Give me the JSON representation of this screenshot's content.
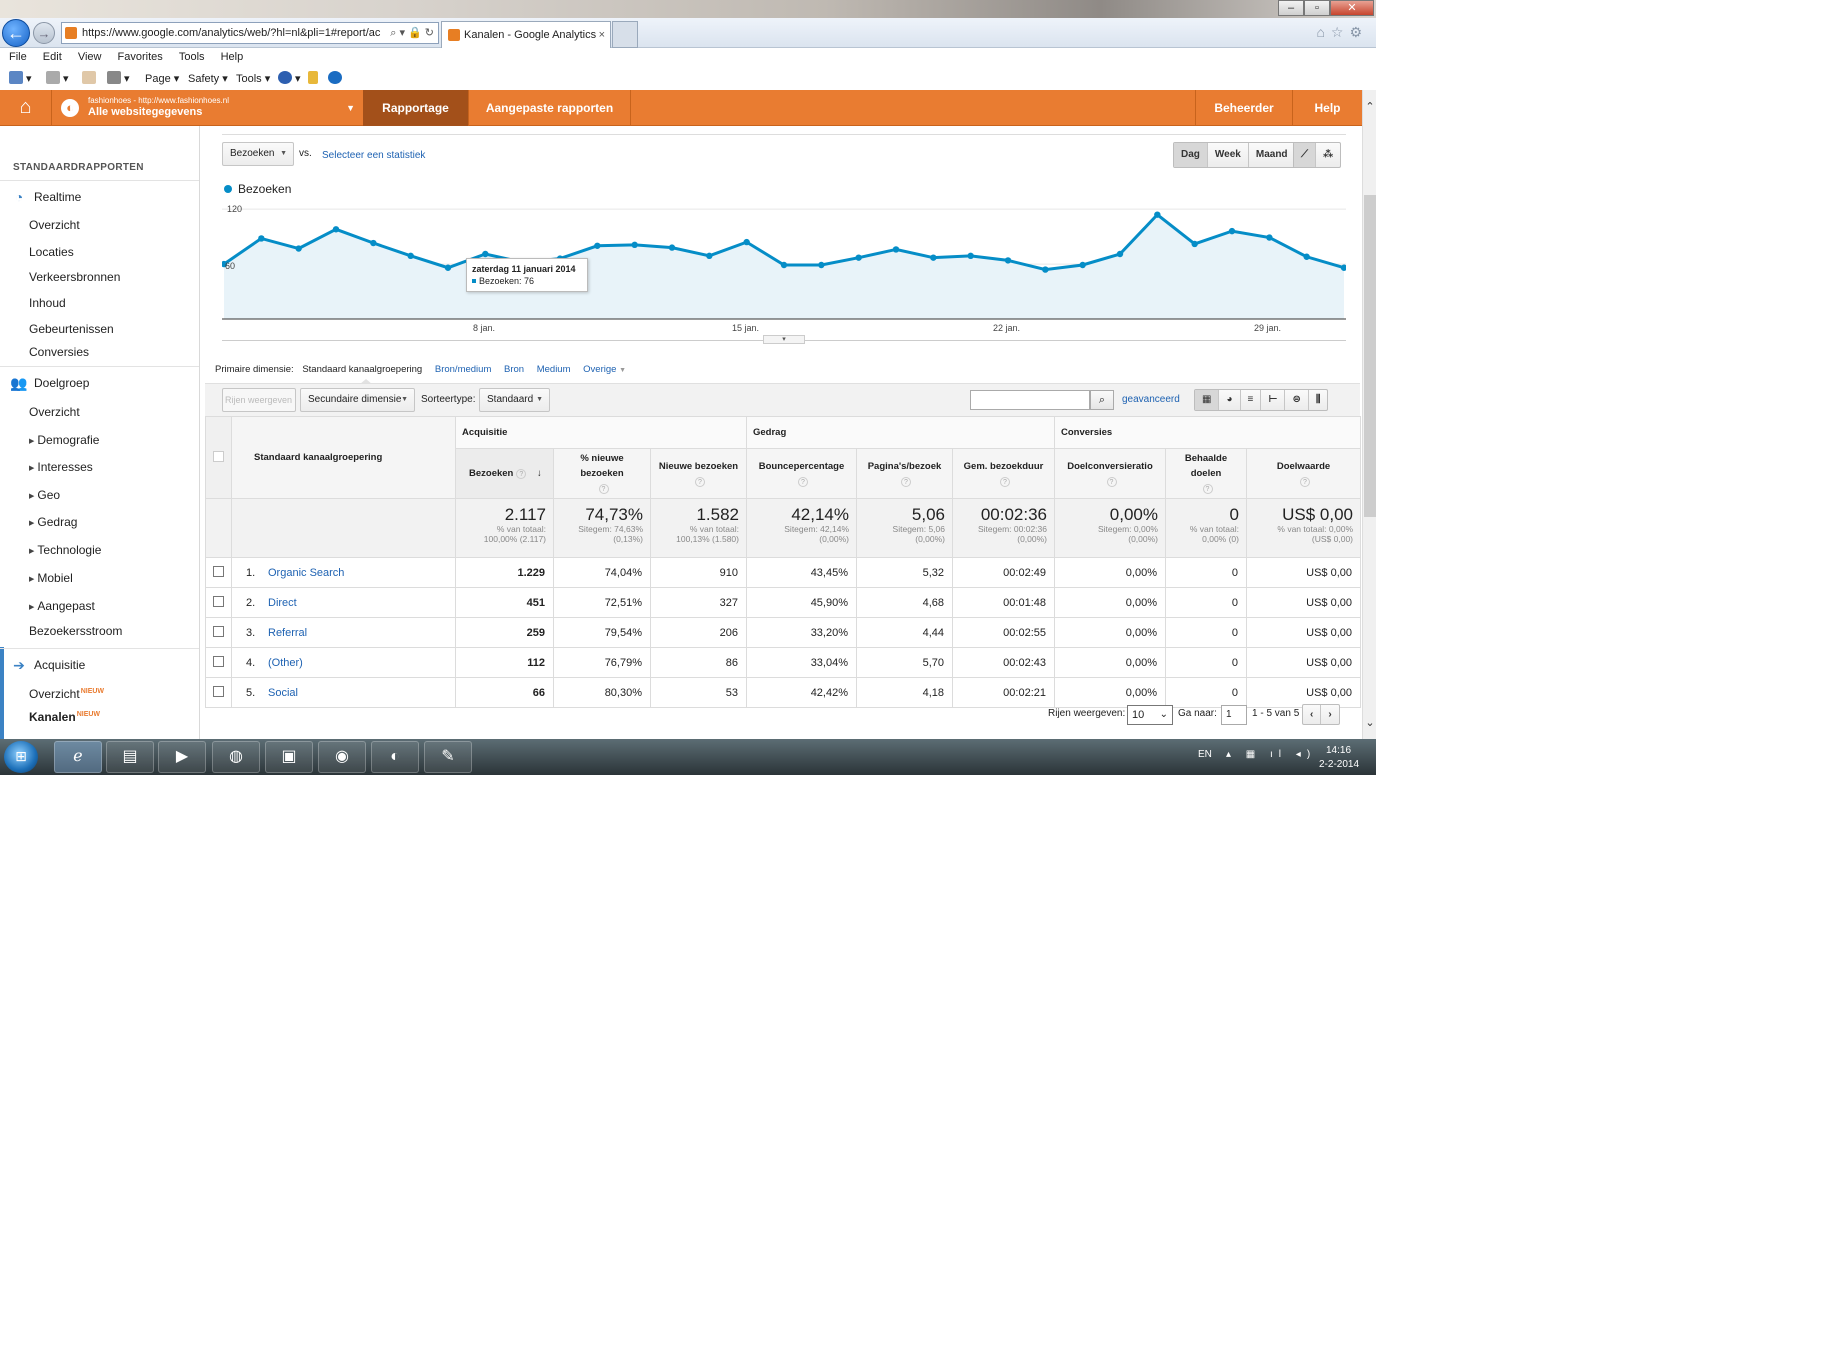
{
  "browser": {
    "url": "https://www.google.com/analytics/web/?hl=nl&pli=1#report/ac",
    "tab_title": "Kanalen - Google Analytics",
    "menu": [
      "File",
      "Edit",
      "View",
      "Favorites",
      "Tools",
      "Help"
    ],
    "commands": {
      "page": "Page",
      "safety": "Safety",
      "tools": "Tools"
    }
  },
  "ga_header": {
    "account_url": "fashionhoes - http://www.fashionhoes.nl",
    "account_view": "Alle websitegegevens",
    "tabs": [
      "Rapportage",
      "Aangepaste rapporten"
    ],
    "right_tabs": [
      "Beheerder",
      "Help"
    ]
  },
  "sidebar": {
    "section_title": "STANDAARDRAPPORTEN",
    "realtime": {
      "label": "Realtime",
      "items": [
        "Overzicht",
        "Locaties",
        "Verkeersbronnen",
        "Inhoud",
        "Gebeurtenissen",
        "Conversies"
      ]
    },
    "doelgroep": {
      "label": "Doelgroep",
      "items": [
        "Overzicht",
        "Demografie",
        "Interesses",
        "Geo",
        "Gedrag",
        "Technologie",
        "Mobiel",
        "Aangepast",
        "Bezoekersstroom"
      ]
    },
    "acquisitie": {
      "label": "Acquisitie",
      "items": [
        "Overzicht",
        "Kanalen"
      ],
      "new_badge": "NIEUW"
    }
  },
  "toolbar": {
    "metric": "Bezoeken",
    "vs": "vs.",
    "select_metric": "Selecteer een statistiek",
    "periods": [
      "Dag",
      "Week",
      "Maand"
    ]
  },
  "chart_data": {
    "type": "line",
    "series": [
      {
        "name": "Bezoeken",
        "color": "#058dc7",
        "values": [
          60,
          88,
          77,
          98,
          83,
          69,
          56,
          71,
          62,
          66,
          80,
          81,
          78,
          69,
          84,
          59,
          59,
          67,
          76,
          67,
          69,
          64,
          54,
          59,
          71,
          114,
          82,
          96,
          89,
          68,
          56
        ]
      }
    ],
    "x": [
      "1 jan.",
      "2 jan.",
      "3 jan.",
      "4 jan.",
      "5 jan.",
      "6 jan.",
      "7 jan.",
      "8 jan.",
      "9 jan.",
      "10 jan.",
      "11 jan.",
      "12 jan.",
      "13 jan.",
      "14 jan.",
      "15 jan.",
      "16 jan.",
      "17 jan.",
      "18 jan.",
      "19 jan.",
      "20 jan.",
      "21 jan.",
      "22 jan.",
      "23 jan.",
      "24 jan.",
      "25 jan.",
      "26 jan.",
      "27 jan.",
      "28 jan.",
      "29 jan.",
      "30 jan.",
      "31 jan."
    ],
    "x_tick_labels": [
      "8 jan.",
      "15 jan.",
      "22 jan.",
      "29 jan."
    ],
    "y_tick_labels": [
      "120",
      "60"
    ],
    "ylim": [
      0,
      130
    ],
    "legend_position": "top-left",
    "tooltip": {
      "title": "zaterdag 11 januari 2014",
      "text": "Bezoeken: 76"
    }
  },
  "dimensions": {
    "label": "Primaire dimensie:",
    "active": "Standaard kanaalgroepering",
    "others": [
      "Bron/medium",
      "Bron",
      "Medium",
      "Overige"
    ]
  },
  "controls": {
    "plot_rows": "Rijen weergeven",
    "secondary": "Secundaire dimensie",
    "sort_label": "Sorteertype:",
    "sort_value": "Standaard",
    "advanced": "geavanceerd"
  },
  "table": {
    "group_headers": [
      "Acquisitie",
      "Gedrag",
      "Conversies"
    ],
    "dimension_header": "Standaard kanaalgroepering",
    "columns": [
      "Bezoeken",
      "% nieuwe bezoeken",
      "Nieuwe bezoeken",
      "Bouncepercentage",
      "Pagina's/bezoek",
      "Gem. bezoekduur",
      "Doelconversieratio",
      "Behaalde doelen",
      "Doelwaarde"
    ],
    "totals": [
      {
        "value": "2.117",
        "sub1": "% van totaal:",
        "sub2": "100,00% (2.117)"
      },
      {
        "value": "74,73%",
        "sub1": "Sitegem: 74,63%",
        "sub2": "(0,13%)"
      },
      {
        "value": "1.582",
        "sub1": "% van totaal:",
        "sub2": "100,13% (1.580)"
      },
      {
        "value": "42,14%",
        "sub1": "Sitegem: 42,14%",
        "sub2": "(0,00%)"
      },
      {
        "value": "5,06",
        "sub1": "Sitegem: 5,06",
        "sub2": "(0,00%)"
      },
      {
        "value": "00:02:36",
        "sub1": "Sitegem: 00:02:36",
        "sub2": "(0,00%)"
      },
      {
        "value": "0,00%",
        "sub1": "Sitegem: 0,00%",
        "sub2": "(0,00%)"
      },
      {
        "value": "0",
        "sub1": "% van totaal:",
        "sub2": "0,00% (0)"
      },
      {
        "value": "US$ 0,00",
        "sub1": "% van totaal: 0,00%",
        "sub2": "(US$ 0,00)"
      }
    ],
    "rows": [
      {
        "idx": "1.",
        "name": "Organic Search",
        "cells": [
          "1.229",
          "74,04%",
          "910",
          "43,45%",
          "5,32",
          "00:02:49",
          "0,00%",
          "0",
          "US$ 0,00"
        ]
      },
      {
        "idx": "2.",
        "name": "Direct",
        "cells": [
          "451",
          "72,51%",
          "327",
          "45,90%",
          "4,68",
          "00:01:48",
          "0,00%",
          "0",
          "US$ 0,00"
        ]
      },
      {
        "idx": "3.",
        "name": "Referral",
        "cells": [
          "259",
          "79,54%",
          "206",
          "33,20%",
          "4,44",
          "00:02:55",
          "0,00%",
          "0",
          "US$ 0,00"
        ]
      },
      {
        "idx": "4.",
        "name": "(Other)",
        "cells": [
          "112",
          "76,79%",
          "86",
          "33,04%",
          "5,70",
          "00:02:43",
          "0,00%",
          "0",
          "US$ 0,00"
        ]
      },
      {
        "idx": "5.",
        "name": "Social",
        "cells": [
          "66",
          "80,30%",
          "53",
          "42,42%",
          "4,18",
          "00:02:21",
          "0,00%",
          "0",
          "US$ 0,00"
        ]
      }
    ]
  },
  "pagination": {
    "rows_label": "Rijen weergeven:",
    "rows_value": "10",
    "goto_label": "Ga naar:",
    "goto_value": "1",
    "range": "1 - 5 van 5"
  },
  "taskbar": {
    "lang": "EN",
    "time": "14:16",
    "date": "2-2-2014"
  }
}
